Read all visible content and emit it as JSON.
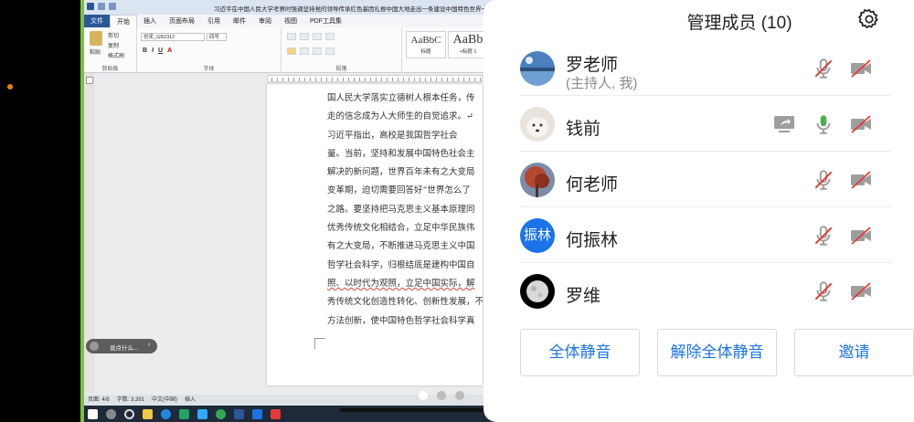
{
  "word": {
    "document_title": "习近平在中国人民大学考察时强调坚持党的领导传承红色基因扎根中国大地走出一条建设中国特色世界一流...",
    "menu": [
      "文件",
      "开始",
      "插入",
      "页面布局",
      "引用",
      "邮件",
      "审阅",
      "视图",
      "PDF工具集"
    ],
    "clipboard": {
      "paste": "粘贴",
      "cut": "剪切",
      "copy": "复制",
      "format_painter": "格式刷",
      "group": "剪贴板"
    },
    "font": {
      "name": "仿宋_GB2312",
      "size": "四号",
      "group": "字体"
    },
    "paragraph": {
      "group": "段落"
    },
    "styles": [
      {
        "sample": "AaBbC",
        "label": "标题"
      },
      {
        "sample": "AaBb",
        "label": "+标题 1"
      }
    ],
    "document_lines": [
      "国人民大学落实立德树人根本任务，传",
      "走的信念成为人大师生的自觉追求。↵",
      "    习近平指出，高校是我国哲学社会",
      "量。当前，坚持和发展中国特色社会主",
      "解决的新问题，世界百年未有之大变局",
      "变革期，迫切需要回答好“世界怎么了",
      "之路。要坚持把马克思主义基本原理同",
      "优秀传统文化相结合，立足中华民族伟",
      "有之大变局，不断推进马克思主义中国",
      "哲学社会科学，归根结底是建构中国自",
      "照、以时代为观照，立足中国实际，解",
      "秀传统文化创造性转化、创新性发展，不",
      "方法创新，使中国特色哲学社会科学真"
    ],
    "assistant_label": "说点什么...",
    "status": {
      "page": "页面: 4/6",
      "words": "字数: 3,391",
      "language": "中文(中国)",
      "mode": "插入"
    }
  },
  "panel": {
    "title": "管理成员 (10)",
    "members": [
      {
        "name": "罗老师",
        "role": "(主持人, 我)",
        "avatar": "lake-photo",
        "mic": "muted",
        "camera": "off"
      },
      {
        "name": "钱前",
        "role": "",
        "avatar": "dog-photo",
        "sharing": true,
        "mic": "on",
        "camera": "off"
      },
      {
        "name": "何老师",
        "role": "",
        "avatar": "tree-photo",
        "mic": "muted",
        "camera": "off"
      },
      {
        "name": "何振林",
        "role": "",
        "avatar": "振林",
        "mic": "muted",
        "camera": "off"
      },
      {
        "name": "罗维",
        "role": "",
        "avatar": "moon-photo",
        "mic": "muted",
        "camera": "off"
      }
    ],
    "buttons": {
      "mute_all": "全体静音",
      "unmute_all": "解除全体静音",
      "invite": "邀请"
    }
  },
  "colors": {
    "accent": "#1a73e8",
    "muted_red": "#e53935",
    "mic_on": "#4caf50",
    "icon_gray": "#9e9e9e"
  }
}
